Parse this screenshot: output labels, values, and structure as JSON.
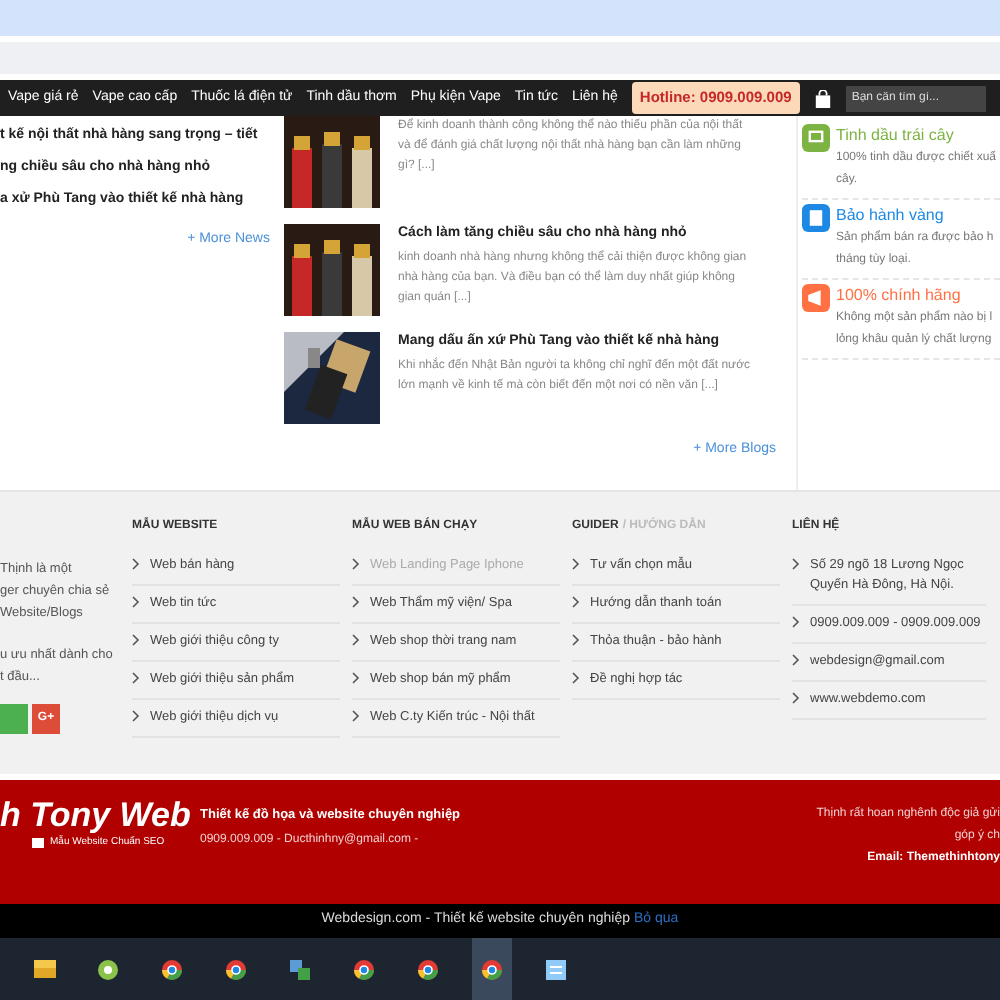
{
  "nav": {
    "items": [
      "Vape giá rẻ",
      "Vape cao cấp",
      "Thuốc lá điện tử",
      "Tinh dầu thơm",
      "Phụ kiện Vape",
      "Tin tức",
      "Liên hệ"
    ],
    "hotline": "Hotline: 0909.009.009",
    "search": {
      "placeholder": "Bạn cần tìm gì..."
    }
  },
  "news": {
    "titles": [
      "t kế nội thất nhà hàng sang trọng – tiết",
      "ng chiều sâu cho nhà hàng nhỏ",
      "a xử Phù Tang vào thiết kế nhà hàng"
    ],
    "more": "+ More News"
  },
  "blogs": {
    "items": [
      {
        "kind": "bottles",
        "excerpt": "Để kinh doanh thành công không thể nào thiếu phần của nội thất và để đánh giá  chất lượng  nội thất nhà hàng bạn cần làm những gì? [...]"
      },
      {
        "kind": "bottles",
        "title": "Cách làm tăng chiều sâu cho nhà hàng nhỏ",
        "excerpt": "kinh doanh nhà hàng nhưng không thể cải thiện được không gian nhà hàng của bạn. Và điều bạn có thể làm duy nhất giúp không gian quán [...]"
      },
      {
        "kind": "device",
        "title": "Mang dấu ấn xứ Phù Tang vào thiết kế nhà hàng",
        "excerpt": "Khi nhắc đến Nhật Bản người ta không chỉ nghĩ đến một đất nước lớn mạnh về kinh tế mà còn biết đến một nơi có nền văn [...]"
      }
    ],
    "more": "+ More Blogs"
  },
  "features": [
    {
      "kind": "screen",
      "title": "Tinh dầu trái cây",
      "color": "#7cb342",
      "lines": [
        "100% tinh dầu được chiết xuấ",
        "cây."
      ]
    },
    {
      "kind": "book",
      "title": "Bảo hành vàng",
      "color": "#1e88e5",
      "lines": [
        "Sản phẩm bán ra được bảo h",
        "tháng tùy loại."
      ]
    },
    {
      "kind": "megaphone",
      "title": "100% chính hãng",
      "color": "#ff7043",
      "lines": [
        "Không một sản phẩm nào bị l",
        "lỏng khâu quản lý chất lượng"
      ]
    }
  ],
  "footer": {
    "about": {
      "lines": [
        "Thịnh là một",
        "ger chuyên chia sẻ",
        "Website/Blogs",
        "u ưu nhất dành cho",
        "t đầu..."
      ],
      "social": [
        {
          "color": "#4caf50"
        },
        {
          "label": "G+",
          "color": "#dd4b39"
        }
      ]
    },
    "columns": [
      {
        "heading": "MẪU WEBSITE",
        "items": [
          {
            "label": "Web bán hàng",
            "dimmed": false
          },
          {
            "label": "Web tin tức",
            "dimmed": false
          },
          {
            "label": "Web giới thiệu công ty",
            "dimmed": false
          },
          {
            "label": "Web giới thiệu sản phẩm",
            "dimmed": false
          },
          {
            "label": "Web giới thiệu dịch vụ",
            "dimmed": false
          }
        ]
      },
      {
        "heading": "MẪU WEB BÁN CHẠY",
        "items": [
          {
            "label": "Web Landing Page Iphone",
            "dimmed": true
          },
          {
            "label": "Web Thẩm mỹ viện/ Spa",
            "dimmed": false
          },
          {
            "label": "Web shop thời trang nam",
            "dimmed": false
          },
          {
            "label": "Web shop bán mỹ phẩm",
            "dimmed": false
          },
          {
            "label": "Web C.ty Kiến trúc - Nội thất",
            "dimmed": false
          }
        ]
      },
      {
        "heading": "GUIDER",
        "heading_sub": "/ HƯỚNG DẪN",
        "items": [
          {
            "label": "Tư vấn chọn mẫu",
            "dimmed": false
          },
          {
            "label": "Hướng dẫn thanh toán",
            "dimmed": false
          },
          {
            "label": "Thỏa thuận - bảo hành",
            "dimmed": false
          },
          {
            "label": "Đề nghị hợp tác",
            "dimmed": false
          }
        ]
      },
      {
        "heading": "LIÊN HỆ",
        "items": [
          {
            "label": "Số 29 ngõ 18 Lương Ngọc Quyến Hà Đông, Hà Nội.",
            "dimmed": false
          },
          {
            "label": "0909.009.009 - 0909.009.009",
            "dimmed": false
          },
          {
            "label": "webdesign@gmail.com",
            "dimmed": false
          },
          {
            "label": "www.webdemo.com",
            "dimmed": false
          }
        ]
      }
    ]
  },
  "brand": {
    "logo": "h Tony Web",
    "tagline": "Mẫu Website Chuẩn SEO",
    "headline": "Thiết kế đồ họa và website chuyên nghiệp",
    "contact": "0909.009.009 - Ducthinhny@gmail.com -",
    "note_lines": [
      "Thịnh rất hoan nghênh độc giả gửi",
      "góp ý ch"
    ],
    "email": "Email: Themethinhtony"
  },
  "bottom_bar": {
    "text": "Webdesign.com - Thiết kế website chuyên nghiệp",
    "link": "Bỏ qua"
  },
  "taskbar": {
    "apps": [
      {
        "kind": "folder",
        "selected": false
      },
      {
        "kind": "tool",
        "selected": false
      },
      {
        "kind": "chrome",
        "selected": false
      },
      {
        "kind": "chrome",
        "selected": false
      },
      {
        "kind": "network",
        "selected": false
      },
      {
        "kind": "chrome",
        "selected": false
      },
      {
        "kind": "chrome",
        "selected": false
      },
      {
        "kind": "chrome",
        "selected": true
      },
      {
        "kind": "notes",
        "selected": false
      }
    ]
  }
}
